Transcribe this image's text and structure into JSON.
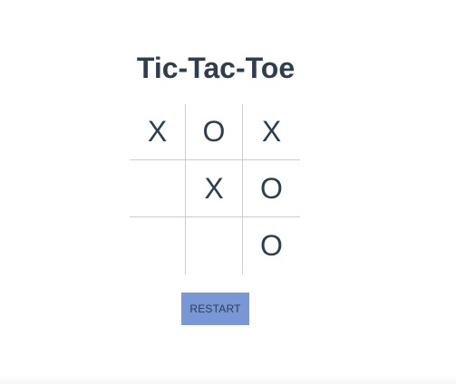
{
  "game": {
    "title": "Tic-Tac-Toe",
    "board": [
      [
        "X",
        "O",
        "X"
      ],
      [
        "",
        "X",
        "O"
      ],
      [
        "",
        "",
        "O"
      ]
    ],
    "restart_label": "RESTART"
  },
  "colors": {
    "text": "#2c3e50",
    "grid_line": "#cccccc",
    "button_bg": "#7897d4"
  }
}
